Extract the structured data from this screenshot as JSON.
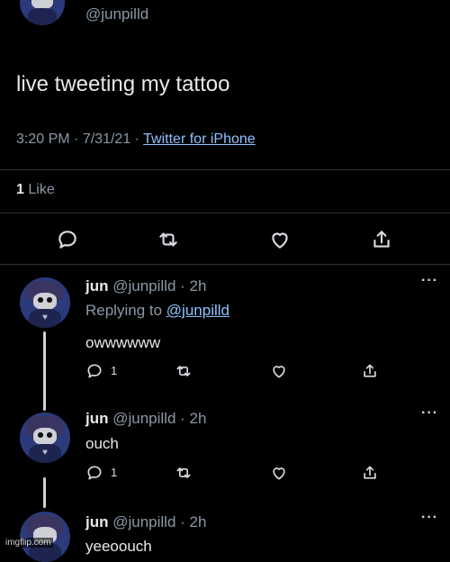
{
  "main_tweet": {
    "handle": "@junpilld",
    "text": "live tweeting my tattoo",
    "time": "3:20 PM",
    "date": "7/31/21",
    "source": "Twitter for iPhone",
    "likes_count": "1",
    "likes_label": "Like"
  },
  "replies": [
    {
      "name": "jun",
      "handle": "@junpilld · 2h",
      "replying_prefix": "Replying to",
      "replying_to": "@junpilld",
      "text": "owwwwww",
      "reply_count": "1"
    },
    {
      "name": "jun",
      "handle": "@junpilld · 2h",
      "text": "ouch",
      "reply_count": "1"
    },
    {
      "name": "jun",
      "handle": "@junpilld · 2h",
      "text": "yeeoouch"
    }
  ],
  "watermark": "imgflip.com",
  "icons": [
    "reply-icon",
    "retweet-icon",
    "like-icon",
    "share-icon",
    "more-icon"
  ],
  "colors": {
    "background": "#000000",
    "text": "#e7e9ea",
    "muted": "#8b98a5",
    "link": "#8ec1ff"
  }
}
